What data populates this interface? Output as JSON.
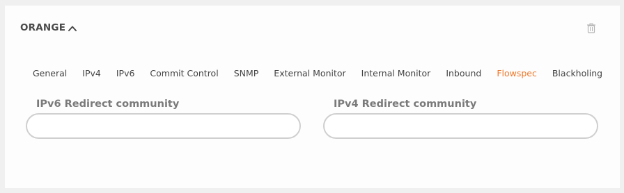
{
  "panel": {
    "title": "ORANGE"
  },
  "icons": {
    "collapse": "chevron-up-icon",
    "delete": "trash-icon"
  },
  "tabs": [
    {
      "label": "General",
      "active": false
    },
    {
      "label": "IPv4",
      "active": false
    },
    {
      "label": "IPv6",
      "active": false
    },
    {
      "label": "Commit Control",
      "active": false
    },
    {
      "label": "SNMP",
      "active": false
    },
    {
      "label": "External Monitor",
      "active": false
    },
    {
      "label": "Internal Monitor",
      "active": false
    },
    {
      "label": "Inbound",
      "active": false
    },
    {
      "label": "Flowspec",
      "active": true
    },
    {
      "label": "Blackholing",
      "active": false
    }
  ],
  "form": {
    "ipv6_redirect": {
      "label": "IPv6 Redirect community",
      "value": ""
    },
    "ipv4_redirect": {
      "label": "IPv4 Redirect community",
      "value": ""
    }
  },
  "colors": {
    "accent": "#f0782a",
    "text": "#444444",
    "label": "#7a7a7a",
    "border": "#cfcfcf"
  }
}
